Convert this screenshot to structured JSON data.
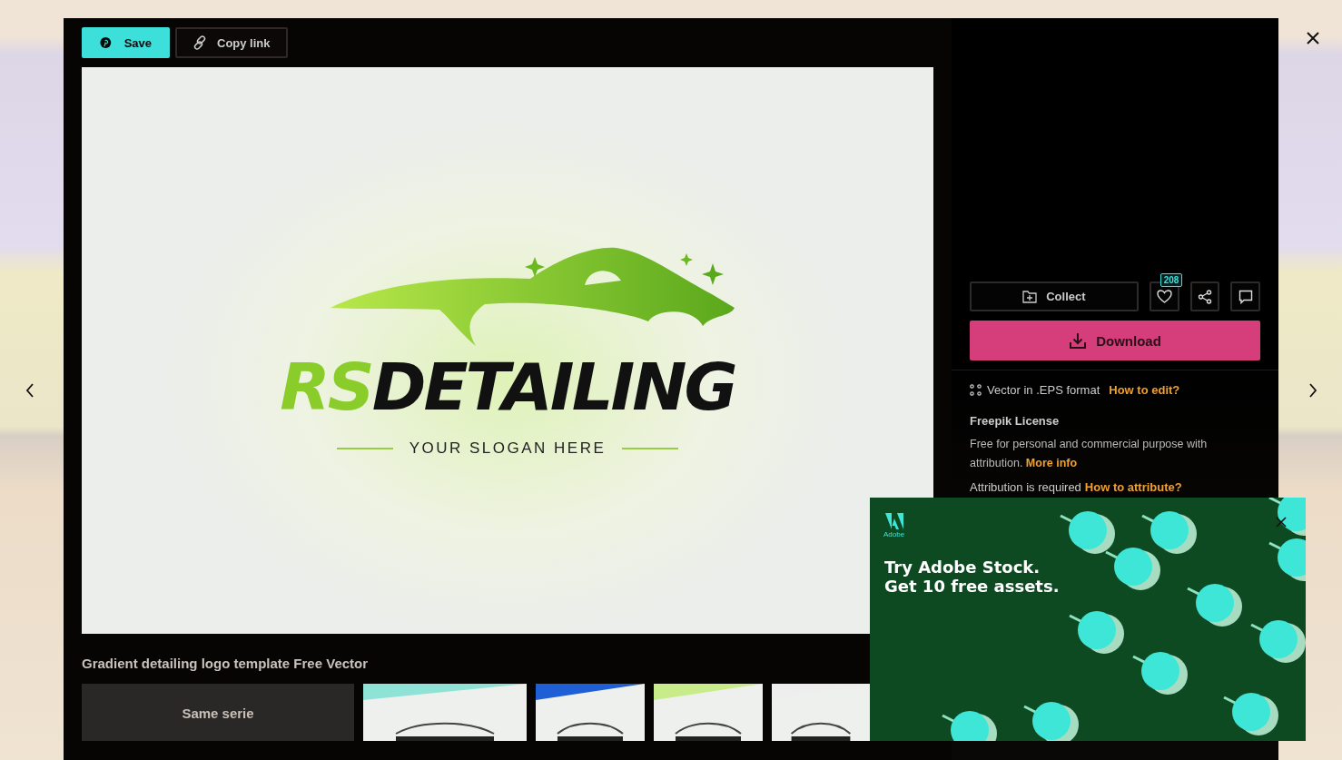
{
  "toolbar": {
    "buttons": [
      {
        "label": "Save",
        "kind": "pinterest"
      },
      {
        "label": "Copy link",
        "kind": "link"
      }
    ]
  },
  "preview": {
    "brand_accent": "RS",
    "brand_main": "DETAILING",
    "slogan": "YOUR SLOGAN HERE"
  },
  "title": "Gradient detailing logo template Free Vector",
  "thumbnails": [
    {
      "kind": "series",
      "label": "Same serie"
    },
    {
      "kind": "picture"
    },
    {
      "kind": "picture"
    },
    {
      "kind": "picture"
    },
    {
      "kind": "picture"
    }
  ],
  "actions": {
    "collect": "Collect",
    "likes": "208",
    "download": "Download"
  },
  "info": {
    "format": "Vector in .EPS format",
    "format_link": "How to edit?",
    "license_title": "Freepik License",
    "license_text": "Free for personal and commercial purpose with attribution.",
    "license_link": "More info",
    "attribution": "Attribution is required",
    "attribution_link": "How to attribute?"
  },
  "ad": {
    "brand": "Adobe",
    "headline": [
      "Try Adobe Stock.",
      "Get 10 free assets."
    ]
  }
}
